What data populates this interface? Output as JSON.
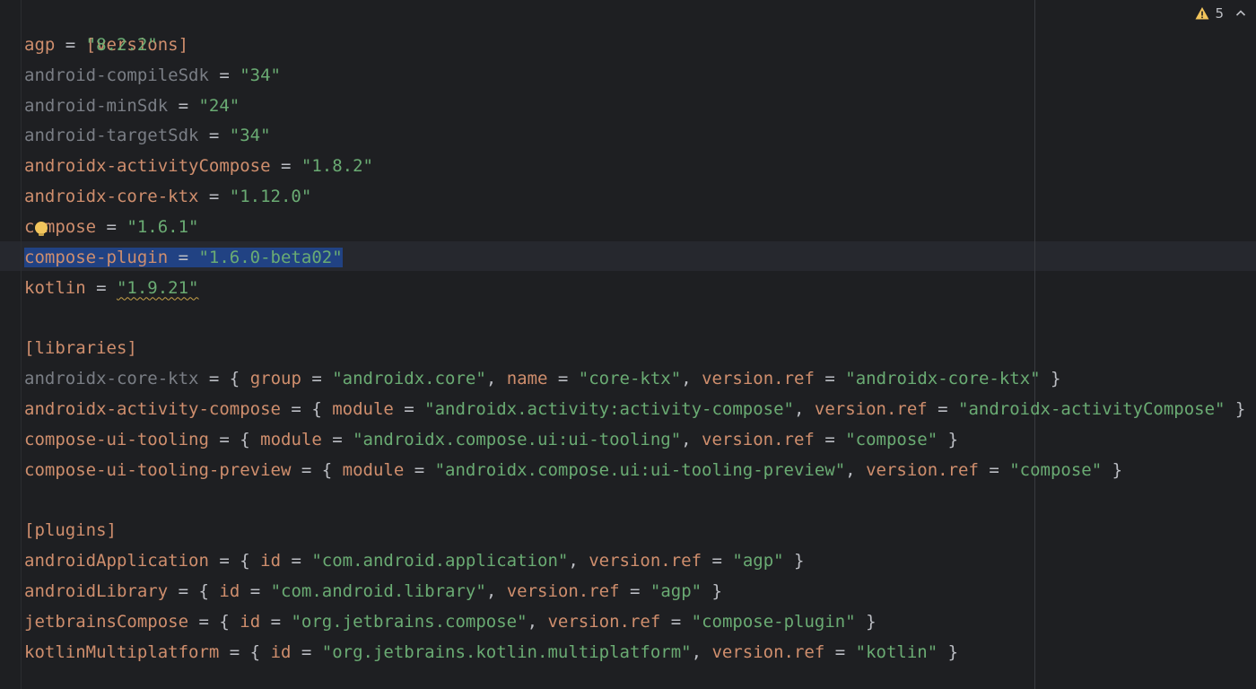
{
  "editor": {
    "warning_count": "5",
    "icons": {
      "warning": "warning-triangle-icon",
      "navigate_up": "chevron-up-icon",
      "intention": "lightbulb-icon"
    },
    "colors": {
      "background": "#1e1f22",
      "key": "#cf8e6d",
      "dim_key": "#7a7e85",
      "string": "#6aab73",
      "selection": "#214283",
      "current_line": "#26282e",
      "warning": "#f2c55c"
    }
  },
  "lines": {
    "l0": "[versions]",
    "l1": {
      "k": "agp",
      "v": "\"8.2.2\""
    },
    "l2": {
      "k": "android-compileSdk",
      "v": "\"34\""
    },
    "l3": {
      "k": "android-minSdk",
      "v": "\"24\""
    },
    "l4": {
      "k": "android-targetSdk",
      "v": "\"34\""
    },
    "l5": {
      "k": "androidx-activityCompose",
      "v": "\"1.8.2\""
    },
    "l6": {
      "k": "androidx-core-ktx",
      "v": "\"1.12.0\""
    },
    "l7": {
      "k": "compose",
      "v": "\"1.6.1\""
    },
    "l8": {
      "k": "compose-plugin",
      "v": "\"1.6.0-beta02\""
    },
    "l9": {
      "k": "kotlin",
      "v": "\"1.9.21\""
    },
    "l11": "[libraries]",
    "l12": {
      "k": "androidx-core-ktx",
      "a1": "group",
      "v1": "\"androidx.core\"",
      "a2": "name",
      "v2": "\"core-ktx\"",
      "a3": "version.ref",
      "v3": "\"androidx-core-ktx\""
    },
    "l13": {
      "k": "androidx-activity-compose",
      "a1": "module",
      "v1": "\"androidx.activity:activity-compose\"",
      "a2": "version.ref",
      "v2": "\"androidx-activityCompose\""
    },
    "l14": {
      "k": "compose-ui-tooling",
      "a1": "module",
      "v1": "\"androidx.compose.ui:ui-tooling\"",
      "a2": "version.ref",
      "v2": "\"compose\""
    },
    "l15": {
      "k": "compose-ui-tooling-preview",
      "a1": "module",
      "v1": "\"androidx.compose.ui:ui-tooling-preview\"",
      "a2": "version.ref",
      "v2": "\"compose\""
    },
    "l17": "[plugins]",
    "l18": {
      "k": "androidApplication",
      "a1": "id",
      "v1": "\"com.android.application\"",
      "a2": "version.ref",
      "v2": "\"agp\""
    },
    "l19": {
      "k": "androidLibrary",
      "a1": "id",
      "v1": "\"com.android.library\"",
      "a2": "version.ref",
      "v2": "\"agp\""
    },
    "l20": {
      "k": "jetbrainsCompose",
      "a1": "id",
      "v1": "\"org.jetbrains.compose\"",
      "a2": "version.ref",
      "v2": "\"compose-plugin\""
    },
    "l21": {
      "k": "kotlinMultiplatform",
      "a1": "id",
      "v1": "\"org.jetbrains.kotlin.multiplatform\"",
      "a2": "version.ref",
      "v2": "\"kotlin\""
    }
  },
  "tokens": {
    "eq": " = ",
    "open": "{ ",
    "close": " }",
    "comma": ", "
  }
}
